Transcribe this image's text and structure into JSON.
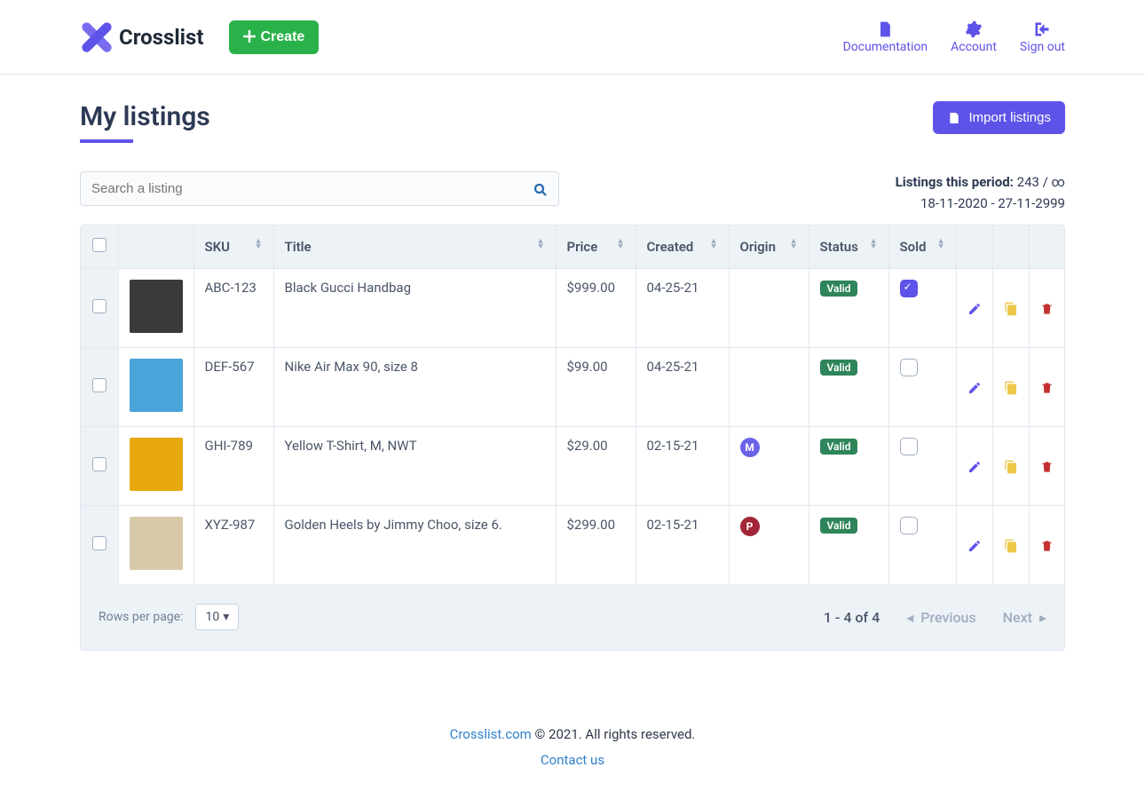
{
  "header": {
    "brand": "Crosslist",
    "create_label": "Create",
    "nav": [
      {
        "label": "Documentation"
      },
      {
        "label": "Account"
      },
      {
        "label": "Sign out"
      }
    ]
  },
  "page": {
    "title": "My listings",
    "import_label": "Import listings",
    "search_placeholder": "Search a listing",
    "period_label": "Listings this period:",
    "period_value": "243 / ∞",
    "period_range": "18-11-2020 - 27-11-2999"
  },
  "columns": {
    "sku": "SKU",
    "title": "Title",
    "price": "Price",
    "created": "Created",
    "origin": "Origin",
    "status": "Status",
    "sold": "Sold"
  },
  "rows": [
    {
      "sku": "ABC-123",
      "title": "Black Gucci Handbag",
      "price": "$999.00",
      "created": "04-25-21",
      "origin": "",
      "origin_color": "",
      "status": "Valid",
      "sold": true,
      "thumb": "#3a3a3a"
    },
    {
      "sku": "DEF-567",
      "title": "Nike Air Max 90, size 8",
      "price": "$99.00",
      "created": "04-25-21",
      "origin": "",
      "origin_color": "",
      "status": "Valid",
      "sold": false,
      "thumb": "#4aa3d9"
    },
    {
      "sku": "GHI-789",
      "title": "Yellow T-Shirt, M, NWT",
      "price": "$29.00",
      "created": "02-15-21",
      "origin": "M",
      "origin_color": "#6b63e8",
      "status": "Valid",
      "sold": false,
      "thumb": "#e8a80d"
    },
    {
      "sku": "XYZ-987",
      "title": "Golden Heels by Jimmy Choo, size 6.",
      "price": "$299.00",
      "created": "02-15-21",
      "origin": "P",
      "origin_color": "#a32638",
      "status": "Valid",
      "sold": false,
      "thumb": "#d8c9a8"
    }
  ],
  "footer": {
    "rows_label": "Rows per page:",
    "rows_value": "10",
    "range": "1 - 4 of 4",
    "prev": "Previous",
    "next": "Next"
  },
  "site_footer": {
    "link": "Crosslist.com",
    "rights": " © 2021. All rights reserved.",
    "contact": "Contact us"
  }
}
